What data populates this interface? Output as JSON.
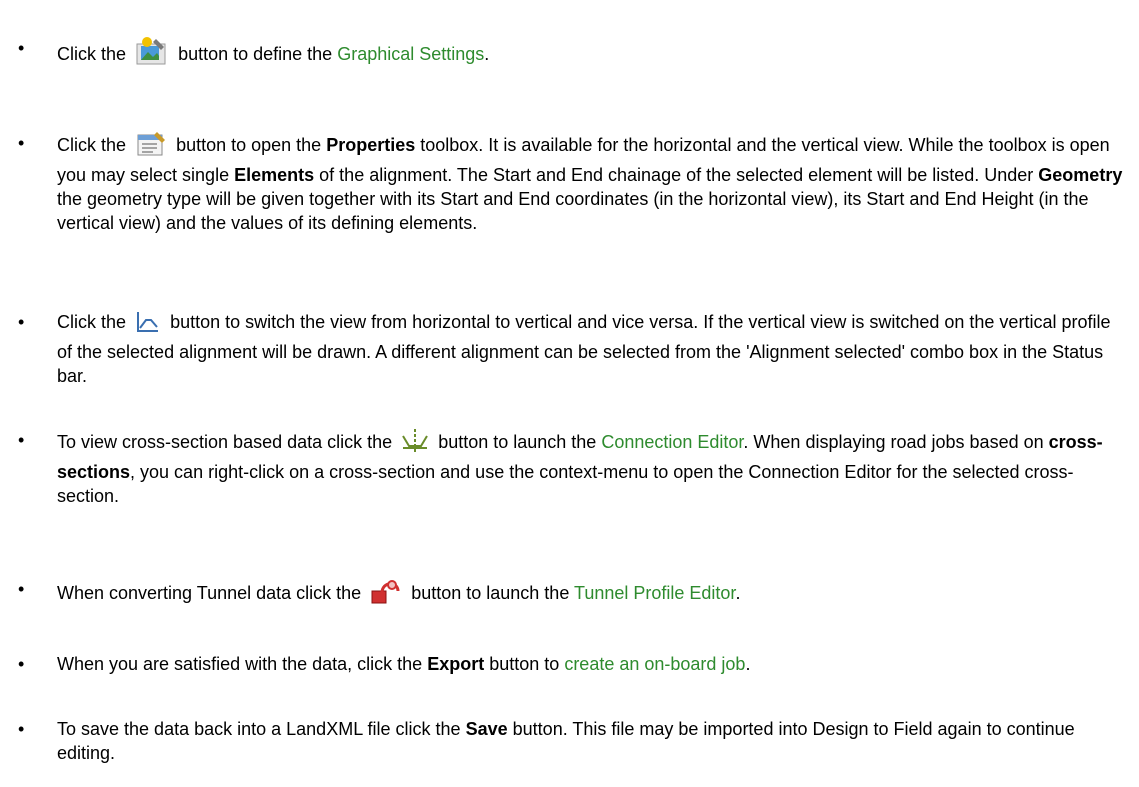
{
  "items": [
    {
      "pre": "Click the",
      "post": "button to define the",
      "link": "Graphical Settings",
      "end": ".",
      "icon": "graphical-settings-icon"
    },
    {
      "pre": "Click the",
      "post1": "button to open the",
      "b1": "Properties",
      "post2": "toolbox. It is available for the horizontal and the vertical view. While the toolbox is open you may select single",
      "b2": "Elements",
      "post3": "of the alignment. The Start and End chainage of the selected element will be listed. Under",
      "b3": "Geometry",
      "post4": "the geometry type will be given together with its Start and End coordinates (in the horizontal view), its Start and End Height (in the vertical view) and the values of its defining elements.",
      "icon": "properties-icon"
    },
    {
      "pre": "Click the",
      "post": "button to switch the view from horizontal to vertical and vice versa. If the vertical view is switched on the vertical profile of the selected alignment will be drawn. A different alignment can be selected from the 'Alignment selected' combo box in the Status bar.",
      "icon": "switch-view-icon"
    },
    {
      "pre": "To view cross-section based data click the",
      "post": "button to launch the",
      "link": "Connection Editor",
      "post2": ". When displaying road jobs based on",
      "b1": "cross-sections",
      "post3": ", you can right-click on a cross-section and use the context-menu to open the Connection Editor for the selected cross-section.",
      "icon": "connection-editor-icon"
    },
    {
      "pre": "When converting Tunnel data click the",
      "post": "button to launch the",
      "link": "Tunnel Profile Editor",
      "end": ".",
      "icon": "tunnel-profile-icon"
    },
    {
      "pre": "When you are satisfied with the data, click the",
      "b1": "Export",
      "post": "button to",
      "link": "create an on-board job",
      "end": "."
    },
    {
      "pre": "To save the data back into a LandXML file click the",
      "b1": "Save",
      "post": "button. This file may be imported into Design to Field again to continue editing."
    }
  ],
  "bullet": "•"
}
